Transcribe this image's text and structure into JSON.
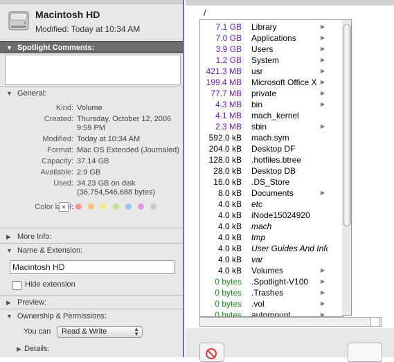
{
  "info": {
    "title": "Macintosh HD",
    "modified_header": "Modified: Today at 10:34 AM",
    "spotlight_comments_label": "Spotlight Comments:",
    "general_label": "General:",
    "general": [
      {
        "key": "Kind:",
        "value": "Volume"
      },
      {
        "key": "Created:",
        "value": "Thursday, October 12, 2006"
      },
      {
        "key": "",
        "value": "9:59 PM"
      },
      {
        "key": "Modified:",
        "value": "Today at 10:34 AM"
      },
      {
        "key": "Format:",
        "value": "Mac OS Extended (Journaled)"
      },
      {
        "key": "Capacity:",
        "value": "37.14 GB"
      },
      {
        "key": "Available:",
        "value": "2.9 GB"
      },
      {
        "key": "Used:",
        "value": "34.23 GB on disk"
      },
      {
        "key": "",
        "value": "(36,754,546,688 bytes)"
      }
    ],
    "color_label": "Color label:",
    "label_colors": [
      "#f29a9a",
      "#f7c47a",
      "#f2ee84",
      "#b7e48e",
      "#9ac8f2",
      "#e69ad8",
      "#c8c8c8"
    ],
    "more_info_label": "More Info:",
    "name_extension_label": "Name & Extension:",
    "name_value": "Macintosh HD",
    "hide_extension_label": "Hide extension",
    "preview_label": "Preview:",
    "ownership_label": "Ownership & Permissions:",
    "you_can_label": "You can",
    "permission_value": "Read & Write",
    "details_label": "Details:"
  },
  "finder": {
    "path": "/",
    "rows": [
      {
        "size": "7.1 GB",
        "name": "Library",
        "color": "#6a1db8",
        "italic": false,
        "arrow": true
      },
      {
        "size": "7.0 GB",
        "name": "Applications",
        "color": "#6a1db8",
        "italic": false,
        "arrow": true
      },
      {
        "size": "3.9 GB",
        "name": "Users",
        "color": "#6a1db8",
        "italic": false,
        "arrow": true
      },
      {
        "size": "1.2 GB",
        "name": "System",
        "color": "#6a1db8",
        "italic": false,
        "arrow": true
      },
      {
        "size": "421.3 MB",
        "name": "usr",
        "color": "#6a1db8",
        "italic": false,
        "arrow": true
      },
      {
        "size": "199.4 MB",
        "name": "Microsoft Office X",
        "color": "#6a1db8",
        "italic": false,
        "arrow": true
      },
      {
        "size": "77.7 MB",
        "name": "private",
        "color": "#6a1db8",
        "italic": false,
        "arrow": true
      },
      {
        "size": "4.3 MB",
        "name": "bin",
        "color": "#6a1db8",
        "italic": false,
        "arrow": true
      },
      {
        "size": "4.1 MB",
        "name": "mach_kernel",
        "color": "#6a1db8",
        "italic": false,
        "arrow": false
      },
      {
        "size": "2.3 MB",
        "name": "sbin",
        "color": "#6a1db8",
        "italic": false,
        "arrow": true
      },
      {
        "size": "592.0 kB",
        "name": "mach.sym",
        "color": "#000000",
        "italic": false,
        "arrow": false
      },
      {
        "size": "204.0 kB",
        "name": "Desktop DF",
        "color": "#000000",
        "italic": false,
        "arrow": false
      },
      {
        "size": "128.0 kB",
        "name": ".hotfiles.btree",
        "color": "#000000",
        "italic": false,
        "arrow": false
      },
      {
        "size": "28.0 kB",
        "name": "Desktop DB",
        "color": "#000000",
        "italic": false,
        "arrow": false
      },
      {
        "size": "16.0 kB",
        "name": ".DS_Store",
        "color": "#000000",
        "italic": false,
        "arrow": false
      },
      {
        "size": "8.0 kB",
        "name": "Documents",
        "color": "#000000",
        "italic": false,
        "arrow": true
      },
      {
        "size": "4.0 kB",
        "name": "etc",
        "color": "#000000",
        "italic": true,
        "arrow": false
      },
      {
        "size": "4.0 kB",
        "name": "iNode15024920",
        "color": "#000000",
        "italic": false,
        "arrow": false
      },
      {
        "size": "4.0 kB",
        "name": "mach",
        "color": "#000000",
        "italic": true,
        "arrow": false
      },
      {
        "size": "4.0 kB",
        "name": "tmp",
        "color": "#000000",
        "italic": true,
        "arrow": false
      },
      {
        "size": "4.0 kB",
        "name": "User Guides And Information",
        "color": "#000000",
        "italic": true,
        "arrow": false
      },
      {
        "size": "4.0 kB",
        "name": "var",
        "color": "#000000",
        "italic": true,
        "arrow": false
      },
      {
        "size": "4.0 kB",
        "name": "Volumes",
        "color": "#000000",
        "italic": false,
        "arrow": true
      },
      {
        "size": "0 bytes",
        "name": ".Spotlight-V100",
        "color": "#1a8a1a",
        "italic": false,
        "arrow": true
      },
      {
        "size": "0 bytes",
        "name": ".Trashes",
        "color": "#1a8a1a",
        "italic": false,
        "arrow": true
      },
      {
        "size": "0 bytes",
        "name": ".vol",
        "color": "#1a8a1a",
        "italic": false,
        "arrow": true
      },
      {
        "size": "0 bytes",
        "name": "automount",
        "color": "#1a8a1a",
        "italic": false,
        "arrow": true
      }
    ]
  }
}
